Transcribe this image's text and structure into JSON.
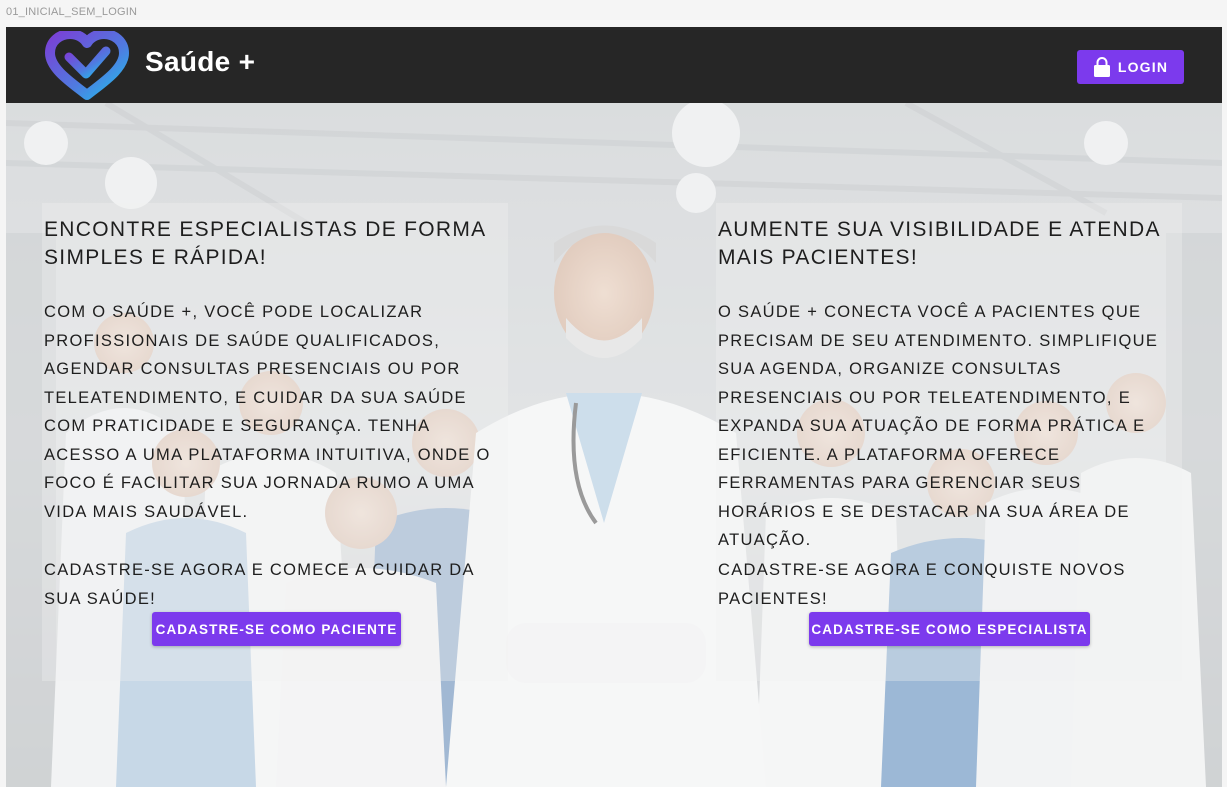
{
  "frame": {
    "label": "01_INICIAL_SEM_LOGIN"
  },
  "header": {
    "brand": "Saúde +",
    "login_label": "LOGIN"
  },
  "patients": {
    "title": "ENCONTRE ESPECIALISTAS DE FORMA SIMPLES E RÁPIDA!",
    "body": "COM O SAÚDE +, VOCÊ PODE LOCALIZAR PROFISSIONAIS DE SAÚDE QUALIFICADOS, AGENDAR CONSULTAS PRESENCIAIS OU POR TELEATENDIMENTO, E CUIDAR DA SUA SAÚDE COM PRATICIDADE E SEGURANÇA. TENHA ACESSO A UMA PLATAFORMA INTUITIVA, ONDE O FOCO É FACILITAR SUA JORNADA RUMO A UMA VIDA MAIS SAUDÁVEL.",
    "cta_text": "CADASTRE-SE AGORA E COMECE A CUIDAR DA SUA SAÚDE!",
    "button_label": "CADASTRE-SE COMO PACIENTE"
  },
  "specialists": {
    "title": "AUMENTE SUA VISIBILIDADE E ATENDA MAIS PACIENTES!",
    "body": "O SAÚDE + CONECTA VOCÊ A PACIENTES QUE PRECISAM DE SEU ATENDIMENTO. SIMPLIFIQUE SUA AGENDA, ORGANIZE CONSULTAS PRESENCIAIS OU POR TELEATENDIMENTO, E EXPANDA SUA ATUAÇÃO DE FORMA PRÁTICA E EFICIENTE. A PLATAFORMA OFERECE FERRAMENTAS PARA GERENCIAR SEUS HORÁRIOS E SE DESTACAR NA SUA ÁREA DE ATUAÇÃO.",
    "cta_text": "CADASTRE-SE AGORA E CONQUISTE NOVOS PACIENTES!",
    "button_label": "CADASTRE-SE COMO ESPECIALISTA"
  },
  "colors": {
    "accent": "#7c3aed",
    "header_bg": "#262626",
    "logo_purple": "#6d3fc4",
    "logo_cyan": "#22b5e6"
  },
  "icons": {
    "login": "lock-icon",
    "logo": "heart-check-logo"
  }
}
